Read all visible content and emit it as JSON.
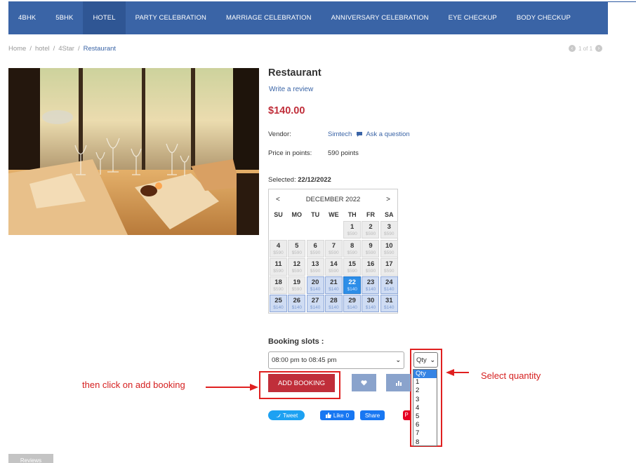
{
  "nav": {
    "items": [
      {
        "label": "4BHK",
        "active": false
      },
      {
        "label": "5BHK",
        "active": false
      },
      {
        "label": "HOTEL",
        "active": true
      },
      {
        "label": "PARTY CELEBRATION",
        "active": false
      },
      {
        "label": "MARRIAGE CELEBRATION",
        "active": false
      },
      {
        "label": "ANNIVERSARY CELEBRATION",
        "active": false
      },
      {
        "label": "EYE CHECKUP",
        "active": false
      },
      {
        "label": "BODY CHECKUP",
        "active": false
      }
    ]
  },
  "breadcrumb": {
    "home": "Home",
    "sep": "/",
    "hotel": "hotel",
    "category": "4Star",
    "current": "Restaurant"
  },
  "pager": {
    "text": "1 of 1",
    "prev_icon": "chevron-left-icon",
    "next_icon": "chevron-right-icon"
  },
  "product": {
    "title": "Restaurant",
    "review_link": "Write a review",
    "price": "$140.00",
    "vendor_label": "Vendor:",
    "vendor_name": "Simtech",
    "ask_question": "Ask a question",
    "points_label": "Price in points:",
    "points_value": "590 points",
    "selected_prefix": "Selected:",
    "selected_date": "22/12/2022"
  },
  "calendar": {
    "prev": "<",
    "next": ">",
    "month": "DECEMBER 2022",
    "weekdays": [
      "SU",
      "MO",
      "TU",
      "WE",
      "TH",
      "FR",
      "SA"
    ],
    "leading_blanks": 4,
    "days": [
      {
        "n": "1",
        "p": "$590",
        "state": "past"
      },
      {
        "n": "2",
        "p": "$590",
        "state": "past"
      },
      {
        "n": "3",
        "p": "$590",
        "state": "past"
      },
      {
        "n": "4",
        "p": "$590",
        "state": "past"
      },
      {
        "n": "5",
        "p": "$590",
        "state": "past"
      },
      {
        "n": "6",
        "p": "$590",
        "state": "past"
      },
      {
        "n": "7",
        "p": "$590",
        "state": "past"
      },
      {
        "n": "8",
        "p": "$590",
        "state": "past"
      },
      {
        "n": "9",
        "p": "$590",
        "state": "past"
      },
      {
        "n": "10",
        "p": "$590",
        "state": "past"
      },
      {
        "n": "11",
        "p": "$590",
        "state": "past"
      },
      {
        "n": "12",
        "p": "$590",
        "state": "past"
      },
      {
        "n": "13",
        "p": "$590",
        "state": "past"
      },
      {
        "n": "14",
        "p": "$590",
        "state": "past"
      },
      {
        "n": "15",
        "p": "$590",
        "state": "past"
      },
      {
        "n": "16",
        "p": "$590",
        "state": "past"
      },
      {
        "n": "17",
        "p": "$590",
        "state": "past"
      },
      {
        "n": "18",
        "p": "$590",
        "state": "past"
      },
      {
        "n": "19",
        "p": "$590",
        "state": "past"
      },
      {
        "n": "20",
        "p": "$140",
        "state": "avail"
      },
      {
        "n": "21",
        "p": "$140",
        "state": "avail"
      },
      {
        "n": "22",
        "p": "$140",
        "state": "sel"
      },
      {
        "n": "23",
        "p": "$140",
        "state": "avail"
      },
      {
        "n": "24",
        "p": "$140",
        "state": "avail"
      },
      {
        "n": "25",
        "p": "$140",
        "state": "avail"
      },
      {
        "n": "26",
        "p": "$140",
        "state": "avail"
      },
      {
        "n": "27",
        "p": "$140",
        "state": "avail"
      },
      {
        "n": "28",
        "p": "$140",
        "state": "avail"
      },
      {
        "n": "29",
        "p": "$140",
        "state": "avail"
      },
      {
        "n": "30",
        "p": "$140",
        "state": "avail"
      },
      {
        "n": "31",
        "p": "$140",
        "state": "avail"
      }
    ]
  },
  "booking": {
    "slots_title": "Booking slots :",
    "slot_value": "08:00 pm to 08:45 pm",
    "qty_value": "Qty",
    "qty_options": [
      "Qty",
      "1",
      "2",
      "3",
      "4",
      "5",
      "6",
      "7",
      "8"
    ],
    "add_label": "ADD BOOKING",
    "wishlist_icon": "heart-icon",
    "compare_icon": "bar-chart-icon"
  },
  "annotations": {
    "left_text": "then click on add booking",
    "right_text": "Select quantity",
    "color": "#e02020"
  },
  "social": {
    "tweet": "Tweet",
    "like": "Like",
    "like_count": "0",
    "share": "Share"
  },
  "tabs": {
    "reviews": "Reviews"
  },
  "colors": {
    "nav_bg": "#3a64a6",
    "price": "#c02e3a",
    "selected_day": "#2d8ee8",
    "available_day": "#cfdcf3"
  }
}
